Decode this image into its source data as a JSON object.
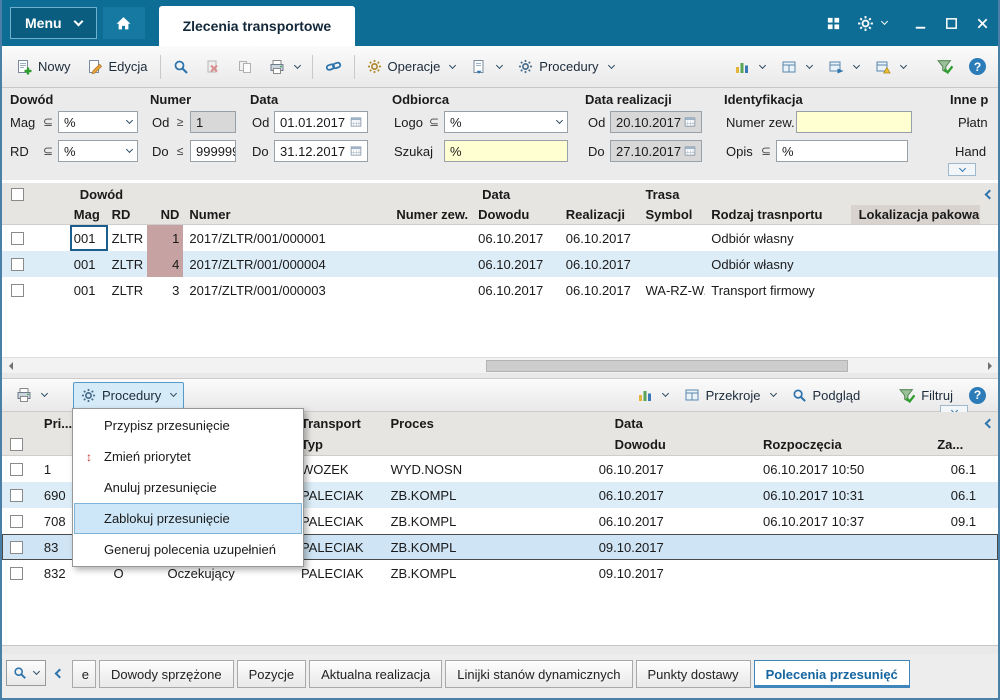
{
  "icons": {
    "help": "?",
    "priority_glyph": "↕"
  },
  "titlebar": {
    "menu_label": "Menu",
    "tab_title": "Zlecenia transportowe"
  },
  "toolbar": {
    "new_label": "Nowy",
    "edit_label": "Edycja",
    "operations_label": "Operacje",
    "procedures_label": "Procedury"
  },
  "filters": {
    "group_dowod": "Dowód",
    "group_numer": "Numer",
    "group_data": "Data",
    "group_odbiorca": "Odbiorca",
    "group_data_realizacji": "Data realizacji",
    "group_identyfikacja": "Identyfikacja",
    "group_inne": "Inne p",
    "mag": {
      "label": "Mag",
      "op": "⊆",
      "value": "%"
    },
    "rd": {
      "label": "RD",
      "op": "⊆",
      "value": "%"
    },
    "numer_od": {
      "label": "Od",
      "op": "≥",
      "value": "1"
    },
    "numer_do": {
      "label": "Do",
      "op": "≤",
      "value": "999999"
    },
    "data_od": {
      "label": "Od",
      "value": "01.01.2017"
    },
    "data_do": {
      "label": "Do",
      "value": "31.12.2017"
    },
    "logo": {
      "label": "Logo",
      "op": "⊆",
      "value": "%"
    },
    "szukaj": {
      "label": "Szukaj",
      "value": "%"
    },
    "realizacja_od": {
      "label": "Od",
      "value": "20.10.2017"
    },
    "realizacja_do": {
      "label": "Do",
      "value": "27.10.2017"
    },
    "numer_zew": {
      "label": "Numer zew.",
      "value": ""
    },
    "opis": {
      "label": "Opis",
      "op": "⊆",
      "value": "%"
    },
    "platnik_label": "Płatn",
    "handlowiec_label": "Hand"
  },
  "grid1": {
    "groups": {
      "dowod": "Dowód",
      "data": "Data",
      "trasa": "Trasa"
    },
    "columns": {
      "mag": "Mag",
      "rd": "RD",
      "nd": "ND",
      "numer": "Numer",
      "numer_zew": "Numer zew.",
      "dowodu": "Dowodu",
      "realizacji": "Realizacji",
      "symbol": "Symbol",
      "rodzaj": "Rodzaj trasnportu",
      "lokalizacja": "Lokalizacja pakowa"
    },
    "rows": [
      {
        "mag": "001",
        "rd": "ZLTR",
        "nd": "1",
        "numer": "2017/ZLTR/001/000001",
        "numer_zew": "",
        "dowodu": "06.10.2017",
        "realizacji": "06.10.2017",
        "symbol": "",
        "rodzaj": "Odbiór własny",
        "lokalizacja": ""
      },
      {
        "mag": "001",
        "rd": "ZLTR",
        "nd": "4",
        "numer": "2017/ZLTR/001/000004",
        "numer_zew": "",
        "dowodu": "06.10.2017",
        "realizacji": "06.10.2017",
        "symbol": "",
        "rodzaj": "Odbiór własny",
        "lokalizacja": ""
      },
      {
        "mag": "001",
        "rd": "ZLTR",
        "nd": "3",
        "numer": "2017/ZLTR/001/000003",
        "numer_zew": "",
        "dowodu": "06.10.2017",
        "realizacji": "06.10.2017",
        "symbol": "WA-RZ-W.",
        "rodzaj": "Transport firmowy",
        "lokalizacja": ""
      }
    ]
  },
  "panel2": {
    "procedures_label": "Procedury",
    "przekroje_label": "Przekroje",
    "podglad_label": "Podgląd",
    "filtruj_label": "Filtruj"
  },
  "context_menu": {
    "items": [
      {
        "label": "Przypisz przesunięcie",
        "highlighted": false
      },
      {
        "label": "Zmień priorytet",
        "highlighted": false
      },
      {
        "label": "Anuluj przesunięcie",
        "highlighted": false
      },
      {
        "label": "Zablokuj przesunięcie",
        "highlighted": true
      },
      {
        "label": "Generuj polecenia uzupełnień",
        "highlighted": false
      }
    ]
  },
  "grid2": {
    "groups": {
      "data": "Data"
    },
    "columns": {
      "pri": "Pri...",
      "transport": "Transport",
      "typ": "Typ",
      "proces": "Proces",
      "dowodu": "Dowodu",
      "rozpoczecia": "Rozpoczęcia",
      "za": "Za..."
    },
    "rows": [
      {
        "pri": "1",
        "status": "",
        "status_name": "",
        "transport": "WOZEK",
        "proces": "WYD.NOSN",
        "dowodu": "06.10.2017",
        "rozpoczecia": "06.10.2017 10:50",
        "za": "06.1"
      },
      {
        "pri": "690",
        "status": "",
        "status_name": "",
        "transport": "PALECIAK",
        "proces": "ZB.KOMPL",
        "dowodu": "06.10.2017",
        "rozpoczecia": "06.10.2017 10:31",
        "za": "06.1"
      },
      {
        "pri": "708",
        "status": "",
        "status_name": "",
        "transport": "PALECIAK",
        "proces": "ZB.KOMPL",
        "dowodu": "06.10.2017",
        "rozpoczecia": "06.10.2017 10:37",
        "za": "09.1"
      },
      {
        "pri": "83",
        "status": "",
        "status_name": "",
        "transport": "PALECIAK",
        "proces": "ZB.KOMPL",
        "dowodu": "09.10.2017",
        "rozpoczecia": "",
        "za": ""
      },
      {
        "pri": "832",
        "status": "O",
        "status_name": "Oczekujący",
        "transport": "PALECIAK",
        "proces": "ZB.KOMPL",
        "dowodu": "09.10.2017",
        "rozpoczecia": "",
        "za": ""
      }
    ]
  },
  "bottom_tabs": {
    "partial": "e",
    "items": [
      "Dowody sprzężone",
      "Pozycje",
      "Aktualna realizacja",
      "Linijki stanów dynamicznych",
      "Punkty dostawy",
      "Polecenia przesunięć"
    ],
    "active": "Polecenia przesunięć"
  }
}
